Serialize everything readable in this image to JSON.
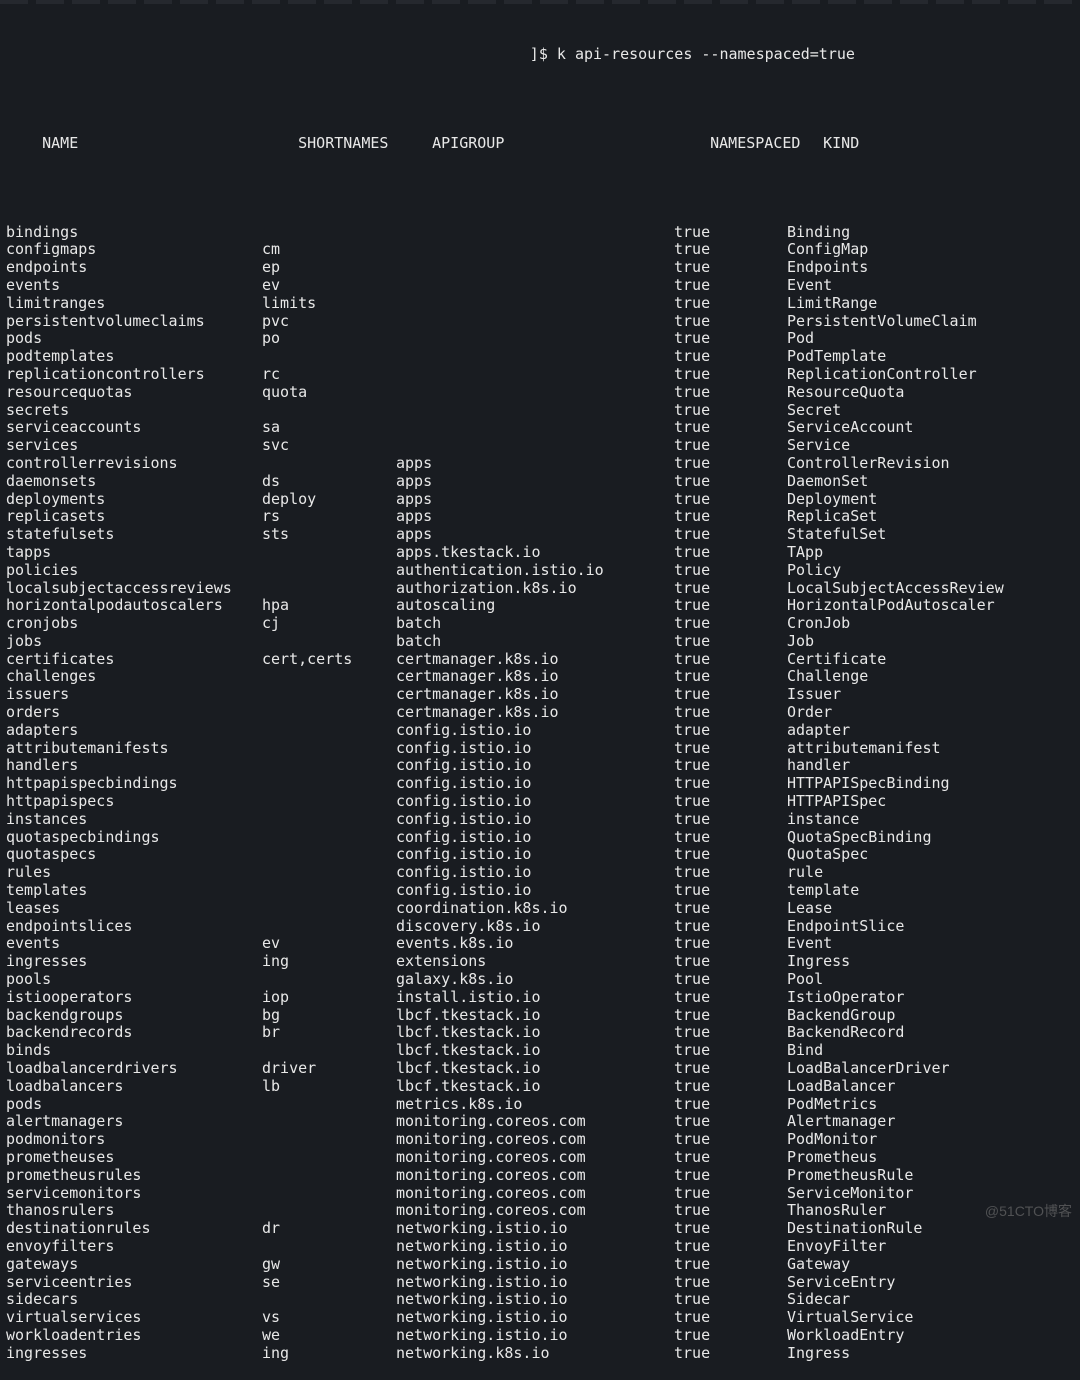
{
  "prompt": {
    "bracket": "]$ ",
    "command": "k api-resources --namespaced=true"
  },
  "columns": {
    "name": "NAME",
    "short": "SHORTNAMES",
    "api": "APIGROUP",
    "ns": "NAMESPACED",
    "kind": "KIND"
  },
  "rows": [
    {
      "name": "bindings",
      "short": "",
      "api": "",
      "ns": "true",
      "kind": "Binding"
    },
    {
      "name": "configmaps",
      "short": "cm",
      "api": "",
      "ns": "true",
      "kind": "ConfigMap"
    },
    {
      "name": "endpoints",
      "short": "ep",
      "api": "",
      "ns": "true",
      "kind": "Endpoints"
    },
    {
      "name": "events",
      "short": "ev",
      "api": "",
      "ns": "true",
      "kind": "Event"
    },
    {
      "name": "limitranges",
      "short": "limits",
      "api": "",
      "ns": "true",
      "kind": "LimitRange"
    },
    {
      "name": "persistentvolumeclaims",
      "short": "pvc",
      "api": "",
      "ns": "true",
      "kind": "PersistentVolumeClaim"
    },
    {
      "name": "pods",
      "short": "po",
      "api": "",
      "ns": "true",
      "kind": "Pod"
    },
    {
      "name": "podtemplates",
      "short": "",
      "api": "",
      "ns": "true",
      "kind": "PodTemplate"
    },
    {
      "name": "replicationcontrollers",
      "short": "rc",
      "api": "",
      "ns": "true",
      "kind": "ReplicationController"
    },
    {
      "name": "resourcequotas",
      "short": "quota",
      "api": "",
      "ns": "true",
      "kind": "ResourceQuota"
    },
    {
      "name": "secrets",
      "short": "",
      "api": "",
      "ns": "true",
      "kind": "Secret"
    },
    {
      "name": "serviceaccounts",
      "short": "sa",
      "api": "",
      "ns": "true",
      "kind": "ServiceAccount"
    },
    {
      "name": "services",
      "short": "svc",
      "api": "",
      "ns": "true",
      "kind": "Service"
    },
    {
      "name": "controllerrevisions",
      "short": "",
      "api": "apps",
      "ns": "true",
      "kind": "ControllerRevision"
    },
    {
      "name": "daemonsets",
      "short": "ds",
      "api": "apps",
      "ns": "true",
      "kind": "DaemonSet"
    },
    {
      "name": "deployments",
      "short": "deploy",
      "api": "apps",
      "ns": "true",
      "kind": "Deployment"
    },
    {
      "name": "replicasets",
      "short": "rs",
      "api": "apps",
      "ns": "true",
      "kind": "ReplicaSet"
    },
    {
      "name": "statefulsets",
      "short": "sts",
      "api": "apps",
      "ns": "true",
      "kind": "StatefulSet"
    },
    {
      "name": "tapps",
      "short": "",
      "api": "apps.tkestack.io",
      "ns": "true",
      "kind": "TApp"
    },
    {
      "name": "policies",
      "short": "",
      "api": "authentication.istio.io",
      "ns": "true",
      "kind": "Policy"
    },
    {
      "name": "localsubjectaccessreviews",
      "short": "",
      "api": "authorization.k8s.io",
      "ns": "true",
      "kind": "LocalSubjectAccessReview"
    },
    {
      "name": "horizontalpodautoscalers",
      "short": "hpa",
      "api": "autoscaling",
      "ns": "true",
      "kind": "HorizontalPodAutoscaler"
    },
    {
      "name": "cronjobs",
      "short": "cj",
      "api": "batch",
      "ns": "true",
      "kind": "CronJob"
    },
    {
      "name": "jobs",
      "short": "",
      "api": "batch",
      "ns": "true",
      "kind": "Job"
    },
    {
      "name": "certificates",
      "short": "cert,certs",
      "api": "certmanager.k8s.io",
      "ns": "true",
      "kind": "Certificate"
    },
    {
      "name": "challenges",
      "short": "",
      "api": "certmanager.k8s.io",
      "ns": "true",
      "kind": "Challenge"
    },
    {
      "name": "issuers",
      "short": "",
      "api": "certmanager.k8s.io",
      "ns": "true",
      "kind": "Issuer"
    },
    {
      "name": "orders",
      "short": "",
      "api": "certmanager.k8s.io",
      "ns": "true",
      "kind": "Order"
    },
    {
      "name": "adapters",
      "short": "",
      "api": "config.istio.io",
      "ns": "true",
      "kind": "adapter"
    },
    {
      "name": "attributemanifests",
      "short": "",
      "api": "config.istio.io",
      "ns": "true",
      "kind": "attributemanifest"
    },
    {
      "name": "handlers",
      "short": "",
      "api": "config.istio.io",
      "ns": "true",
      "kind": "handler"
    },
    {
      "name": "httpapispecbindings",
      "short": "",
      "api": "config.istio.io",
      "ns": "true",
      "kind": "HTTPAPISpecBinding"
    },
    {
      "name": "httpapispecs",
      "short": "",
      "api": "config.istio.io",
      "ns": "true",
      "kind": "HTTPAPISpec"
    },
    {
      "name": "instances",
      "short": "",
      "api": "config.istio.io",
      "ns": "true",
      "kind": "instance"
    },
    {
      "name": "quotaspecbindings",
      "short": "",
      "api": "config.istio.io",
      "ns": "true",
      "kind": "QuotaSpecBinding"
    },
    {
      "name": "quotaspecs",
      "short": "",
      "api": "config.istio.io",
      "ns": "true",
      "kind": "QuotaSpec"
    },
    {
      "name": "rules",
      "short": "",
      "api": "config.istio.io",
      "ns": "true",
      "kind": "rule"
    },
    {
      "name": "templates",
      "short": "",
      "api": "config.istio.io",
      "ns": "true",
      "kind": "template"
    },
    {
      "name": "leases",
      "short": "",
      "api": "coordination.k8s.io",
      "ns": "true",
      "kind": "Lease"
    },
    {
      "name": "endpointslices",
      "short": "",
      "api": "discovery.k8s.io",
      "ns": "true",
      "kind": "EndpointSlice"
    },
    {
      "name": "events",
      "short": "ev",
      "api": "events.k8s.io",
      "ns": "true",
      "kind": "Event"
    },
    {
      "name": "ingresses",
      "short": "ing",
      "api": "extensions",
      "ns": "true",
      "kind": "Ingress"
    },
    {
      "name": "pools",
      "short": "",
      "api": "galaxy.k8s.io",
      "ns": "true",
      "kind": "Pool"
    },
    {
      "name": "istiooperators",
      "short": "iop",
      "api": "install.istio.io",
      "ns": "true",
      "kind": "IstioOperator"
    },
    {
      "name": "backendgroups",
      "short": "bg",
      "api": "lbcf.tkestack.io",
      "ns": "true",
      "kind": "BackendGroup"
    },
    {
      "name": "backendrecords",
      "short": "br",
      "api": "lbcf.tkestack.io",
      "ns": "true",
      "kind": "BackendRecord"
    },
    {
      "name": "binds",
      "short": "",
      "api": "lbcf.tkestack.io",
      "ns": "true",
      "kind": "Bind"
    },
    {
      "name": "loadbalancerdrivers",
      "short": "driver",
      "api": "lbcf.tkestack.io",
      "ns": "true",
      "kind": "LoadBalancerDriver"
    },
    {
      "name": "loadbalancers",
      "short": "lb",
      "api": "lbcf.tkestack.io",
      "ns": "true",
      "kind": "LoadBalancer"
    },
    {
      "name": "pods",
      "short": "",
      "api": "metrics.k8s.io",
      "ns": "true",
      "kind": "PodMetrics"
    },
    {
      "name": "alertmanagers",
      "short": "",
      "api": "monitoring.coreos.com",
      "ns": "true",
      "kind": "Alertmanager"
    },
    {
      "name": "podmonitors",
      "short": "",
      "api": "monitoring.coreos.com",
      "ns": "true",
      "kind": "PodMonitor"
    },
    {
      "name": "prometheuses",
      "short": "",
      "api": "monitoring.coreos.com",
      "ns": "true",
      "kind": "Prometheus"
    },
    {
      "name": "prometheusrules",
      "short": "",
      "api": "monitoring.coreos.com",
      "ns": "true",
      "kind": "PrometheusRule"
    },
    {
      "name": "servicemonitors",
      "short": "",
      "api": "monitoring.coreos.com",
      "ns": "true",
      "kind": "ServiceMonitor"
    },
    {
      "name": "thanosrulers",
      "short": "",
      "api": "monitoring.coreos.com",
      "ns": "true",
      "kind": "ThanosRuler"
    },
    {
      "name": "destinationrules",
      "short": "dr",
      "api": "networking.istio.io",
      "ns": "true",
      "kind": "DestinationRule"
    },
    {
      "name": "envoyfilters",
      "short": "",
      "api": "networking.istio.io",
      "ns": "true",
      "kind": "EnvoyFilter"
    },
    {
      "name": "gateways",
      "short": "gw",
      "api": "networking.istio.io",
      "ns": "true",
      "kind": "Gateway"
    },
    {
      "name": "serviceentries",
      "short": "se",
      "api": "networking.istio.io",
      "ns": "true",
      "kind": "ServiceEntry"
    },
    {
      "name": "sidecars",
      "short": "",
      "api": "networking.istio.io",
      "ns": "true",
      "kind": "Sidecar"
    },
    {
      "name": "virtualservices",
      "short": "vs",
      "api": "networking.istio.io",
      "ns": "true",
      "kind": "VirtualService"
    },
    {
      "name": "workloadentries",
      "short": "we",
      "api": "networking.istio.io",
      "ns": "true",
      "kind": "WorkloadEntry"
    },
    {
      "name": "ingresses",
      "short": "ing",
      "api": "networking.k8s.io",
      "ns": "true",
      "kind": "Ingress"
    }
  ],
  "watermark": "@51CTO博客"
}
